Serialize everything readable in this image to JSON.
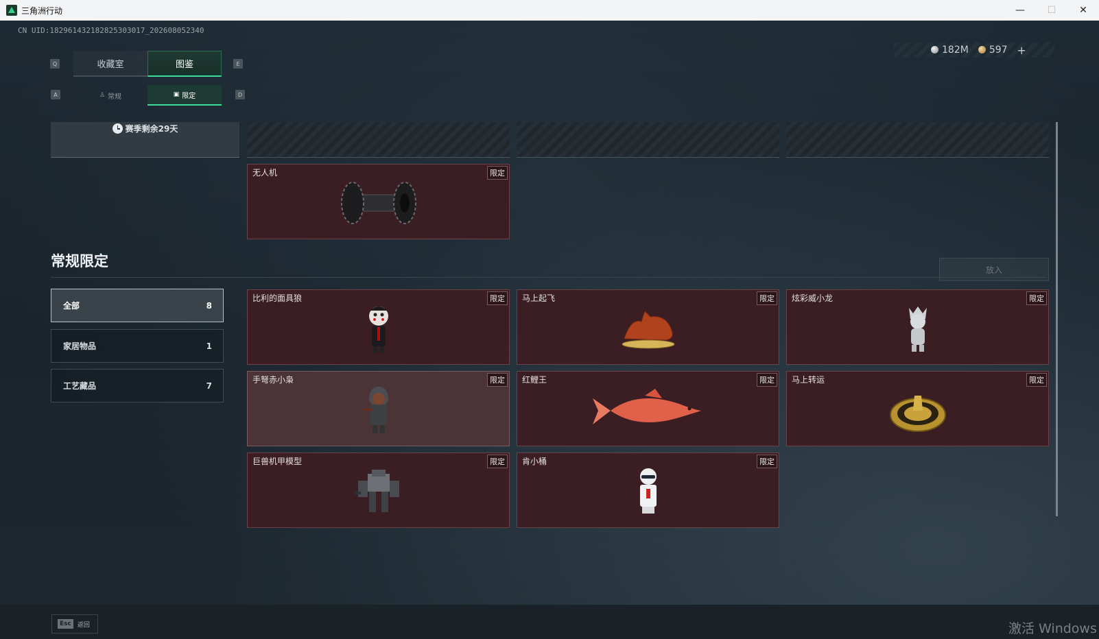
{
  "window": {
    "title": "三角洲行动",
    "minimize": "—",
    "maximize": "☐",
    "close": "✕"
  },
  "header": {
    "uid": "CN UID:182961432182825303017_202608052340",
    "silver_amount": "182M",
    "gold_amount": "597",
    "add_label": "+"
  },
  "key_hints": {
    "q": "Q",
    "e": "E",
    "a": "A",
    "d": "D"
  },
  "tabs": [
    {
      "label": "收藏室",
      "active": false
    },
    {
      "label": "图鉴",
      "active": true
    }
  ],
  "subtabs": [
    {
      "label": "常规",
      "icon": "figure-icon",
      "active": false
    },
    {
      "label": "限定",
      "icon": "picture-icon",
      "active": true
    }
  ],
  "season": {
    "text": "赛季剩余29天"
  },
  "featured": {
    "name": "无人机",
    "badge": "限定"
  },
  "section": {
    "title": "常规限定",
    "place_button": "放入"
  },
  "filters": [
    {
      "label": "全部",
      "count": "8",
      "active": true
    },
    {
      "label": "家居物品",
      "count": "1",
      "active": false
    },
    {
      "label": "工艺藏品",
      "count": "7",
      "active": false
    }
  ],
  "items": [
    {
      "name": "比利的面具狼",
      "badge": "限定",
      "art": "puppet-figure"
    },
    {
      "name": "马上起飞",
      "badge": "限定",
      "art": "horse-sculpture"
    },
    {
      "name": "炫彩威小龙",
      "badge": "限定",
      "art": "dragon-figure"
    },
    {
      "name": "手弩赤小枭",
      "badge": "限定",
      "art": "hooded-figure"
    },
    {
      "name": "红鲤王",
      "badge": "限定",
      "art": "red-carp"
    },
    {
      "name": "马上转运",
      "badge": "限定",
      "art": "gold-spinner"
    },
    {
      "name": "巨兽机甲模型",
      "badge": "限定",
      "art": "mech-model"
    },
    {
      "name": "肯小桶",
      "badge": "限定",
      "art": "bucket-figure"
    }
  ],
  "footer": {
    "esc_key": "Esc",
    "back_label": "返回",
    "activation_watermark": "激活 Windows"
  },
  "colors": {
    "accent": "#3fdc9c",
    "card_bg": "#3a1e24",
    "card_border": "#6d4148",
    "background": "#1c262e"
  }
}
